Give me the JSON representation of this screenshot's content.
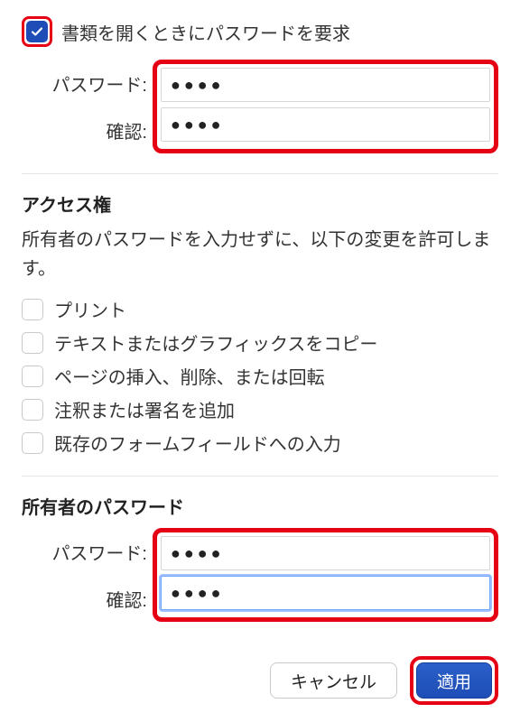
{
  "require_password_label": "書類を開くときにパスワードを要求",
  "password_section": {
    "password_label": "パスワード:",
    "confirm_label": "確認:",
    "password_value": "●●●●",
    "confirm_value": "●●●●"
  },
  "permissions": {
    "title": "アクセス権",
    "description": "所有者のパスワードを入力せずに、以下の変更を許可します。",
    "items": [
      "プリント",
      "テキストまたはグラフィックスをコピー",
      "ページの挿入、削除、または回転",
      "注釈または署名を追加",
      "既存のフォームフィールドへの入力"
    ]
  },
  "owner_password": {
    "title": "所有者のパスワード",
    "password_label": "パスワード:",
    "confirm_label": "確認:",
    "password_value": "●●●●",
    "confirm_value": "●●●●"
  },
  "buttons": {
    "cancel": "キャンセル",
    "apply": "適用"
  }
}
